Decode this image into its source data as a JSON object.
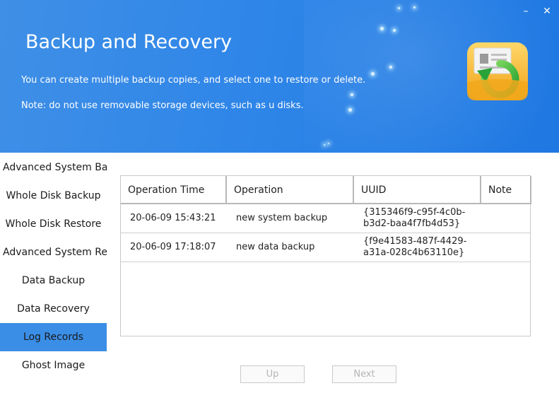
{
  "header": {
    "title": "Backup and Recovery",
    "description_line1": "You can create multiple backup copies, and select one to restore or delete.",
    "description_line2": "Note: do not use removable storage devices, such as u disks.",
    "minimize_glyph": "–",
    "close_glyph": "✕",
    "icon": "backup-recovery-app-icon"
  },
  "sidebar": {
    "items": [
      {
        "label": "Advanced System Backup",
        "align": "left"
      },
      {
        "label": "Whole Disk Backup",
        "align": "center"
      },
      {
        "label": "Whole Disk Restore",
        "align": "center"
      },
      {
        "label": "Advanced System Restore",
        "align": "left"
      },
      {
        "label": "Data Backup",
        "align": "center"
      },
      {
        "label": "Data Recovery",
        "align": "center"
      },
      {
        "label": "Log Records",
        "align": "center",
        "active": true
      },
      {
        "label": "Ghost Image",
        "align": "center"
      }
    ]
  },
  "table": {
    "columns": [
      "Operation Time",
      "Operation",
      "UUID",
      "Note"
    ],
    "rows": [
      {
        "time": "20-06-09 15:43:21",
        "operation": "new system backup",
        "uuid_line1": "{315346f9-c95f-4c0b-",
        "uuid_line2": "b3d2-baa4f7fb4d53}",
        "note": ""
      },
      {
        "time": "20-06-09 17:18:07",
        "operation": "new data backup",
        "uuid_line1": "{f9e41583-487f-4429-",
        "uuid_line2": "a31a-028c4b63110e}",
        "note": ""
      }
    ]
  },
  "pagination": {
    "up_label": "Up",
    "next_label": "Next"
  },
  "colors": {
    "header_blue": "#2f86e8",
    "active_item": "#3a8ee6"
  }
}
